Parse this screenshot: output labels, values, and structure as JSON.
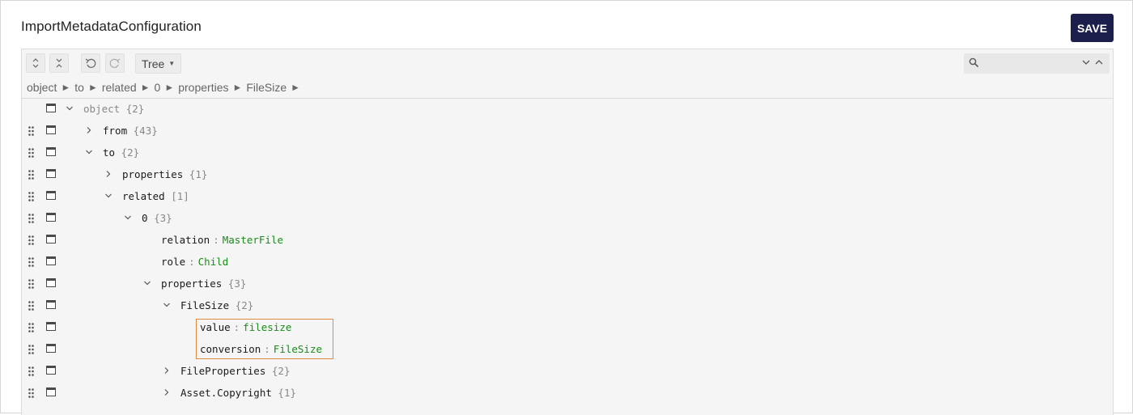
{
  "page": {
    "title": "ImportMetadataConfiguration",
    "save_label": "SAVE"
  },
  "toolbar": {
    "expand_all_icon": "expand-all-icon",
    "collapse_all_icon": "collapse-all-icon",
    "undo_icon": "undo-icon",
    "redo_icon": "redo-icon",
    "mode_label": "Tree",
    "search_placeholder": ""
  },
  "breadcrumb": [
    "object",
    "to",
    "related",
    "0",
    "properties",
    "FileSize"
  ],
  "breadcrumb_separator": "►",
  "tree": {
    "rows": [
      {
        "key": "object",
        "meta": "{2}",
        "toggle": "open"
      },
      {
        "key": "from",
        "meta": "{43}",
        "toggle": "closed"
      },
      {
        "key": "to",
        "meta": "{2}",
        "toggle": "open"
      },
      {
        "key": "properties",
        "meta": "{1}",
        "toggle": "closed"
      },
      {
        "key": "related",
        "meta": "[1]",
        "toggle": "open"
      },
      {
        "key": "0",
        "meta": "{3}",
        "toggle": "open"
      },
      {
        "key": "relation",
        "sep": ":",
        "value": "MasterFile"
      },
      {
        "key": "role",
        "sep": ":",
        "value": "Child"
      },
      {
        "key": "properties",
        "meta": "{3}",
        "toggle": "open"
      },
      {
        "key": "FileSize",
        "meta": "{2}",
        "toggle": "open"
      },
      {
        "key": "value",
        "sep": ":",
        "value": "filesize"
      },
      {
        "key": "conversion",
        "sep": ":",
        "value": "FileSize"
      },
      {
        "key": "FileProperties",
        "meta": "{2}",
        "toggle": "closed"
      },
      {
        "key": "Asset.Copyright",
        "meta": "{1}",
        "toggle": "closed"
      }
    ]
  },
  "colors": {
    "save_button": "#1c1f4b",
    "value_text": "#1a8c1a",
    "highlight_border": "#e08a3c"
  }
}
